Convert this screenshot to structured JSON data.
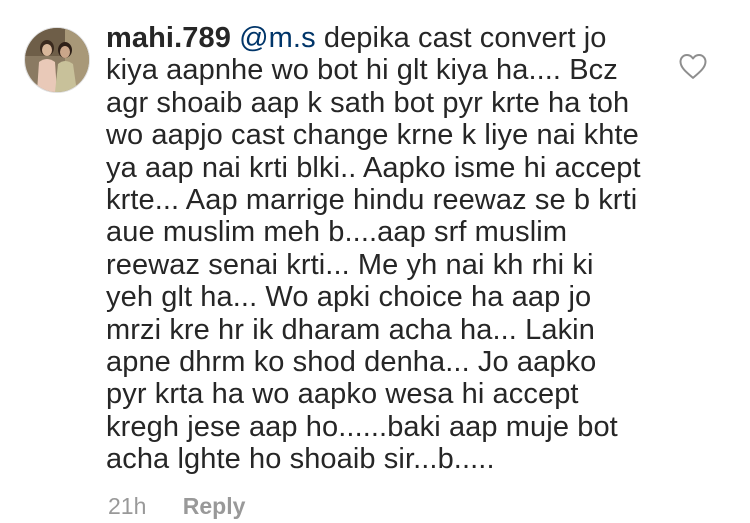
{
  "comment": {
    "username": "mahi.789",
    "mention": "@m.s",
    "first_line_rest": "depika cast convert jo",
    "lines": [
      "kiya aapnhe wo bot hi glt kiya ha.... Bcz",
      "agr shoaib aap k sath bot pyr krte ha toh",
      "wo aapjo cast change krne k liye nai khte",
      "ya aap nai krti blki.. Aapko isme hi accept",
      "krte... Aap marrige hindu reewaz se b krti",
      "aue muslim meh b....aap srf muslim",
      "reewaz senai krti... Me yh nai kh rhi ki",
      "yeh glt ha... Wo apki choice ha aap jo",
      "mrzi kre hr ik dharam acha ha... Lakin",
      "apne dhrm ko shod denha... Jo aapko",
      "pyr krta ha wo aapko wesa hi accept",
      "kregh jese aap ho......baki aap muje bot",
      "acha lghte ho shoaib sir...b....."
    ],
    "timestamp": "21h",
    "reply_label": "Reply"
  },
  "icons": {
    "avatar": "profile-avatar",
    "like": "heart-outline-icon"
  },
  "colors": {
    "text": "#262626",
    "mention": "#003569",
    "meta": "#999999",
    "background": "#ffffff"
  }
}
